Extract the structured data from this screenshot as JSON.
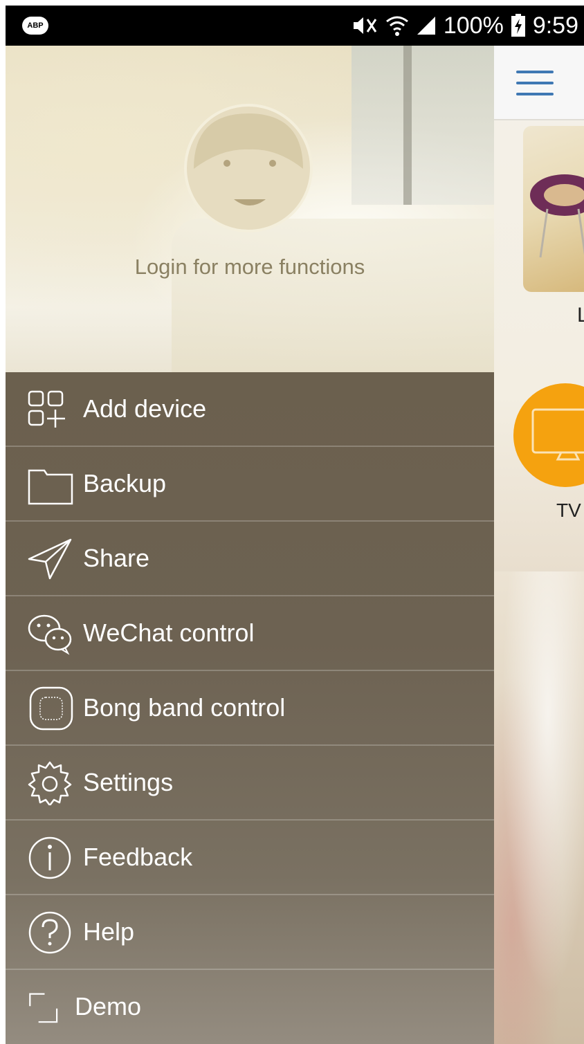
{
  "status_bar": {
    "left_badge": "ABP",
    "battery": "100%",
    "time": "9:59"
  },
  "drawer": {
    "login_prompt": "Login for more functions",
    "menu": [
      {
        "label": "Add device",
        "icon": "add-device-icon"
      },
      {
        "label": "Backup",
        "icon": "folder-icon"
      },
      {
        "label": "Share",
        "icon": "send-icon"
      },
      {
        "label": "WeChat control",
        "icon": "wechat-icon"
      },
      {
        "label": "Bong band control",
        "icon": "band-icon"
      },
      {
        "label": "Settings",
        "icon": "gear-icon"
      },
      {
        "label": "Feedback",
        "icon": "info-icon"
      },
      {
        "label": "Help",
        "icon": "help-icon"
      },
      {
        "label": "Demo",
        "icon": "demo-frame-icon"
      }
    ]
  },
  "main": {
    "card_label_partial": "L",
    "tv_label": "TV"
  },
  "colors": {
    "accent_blue": "#3f78b3",
    "tv_orange": "#f5a20f",
    "menu_bg": "#6b604e"
  }
}
